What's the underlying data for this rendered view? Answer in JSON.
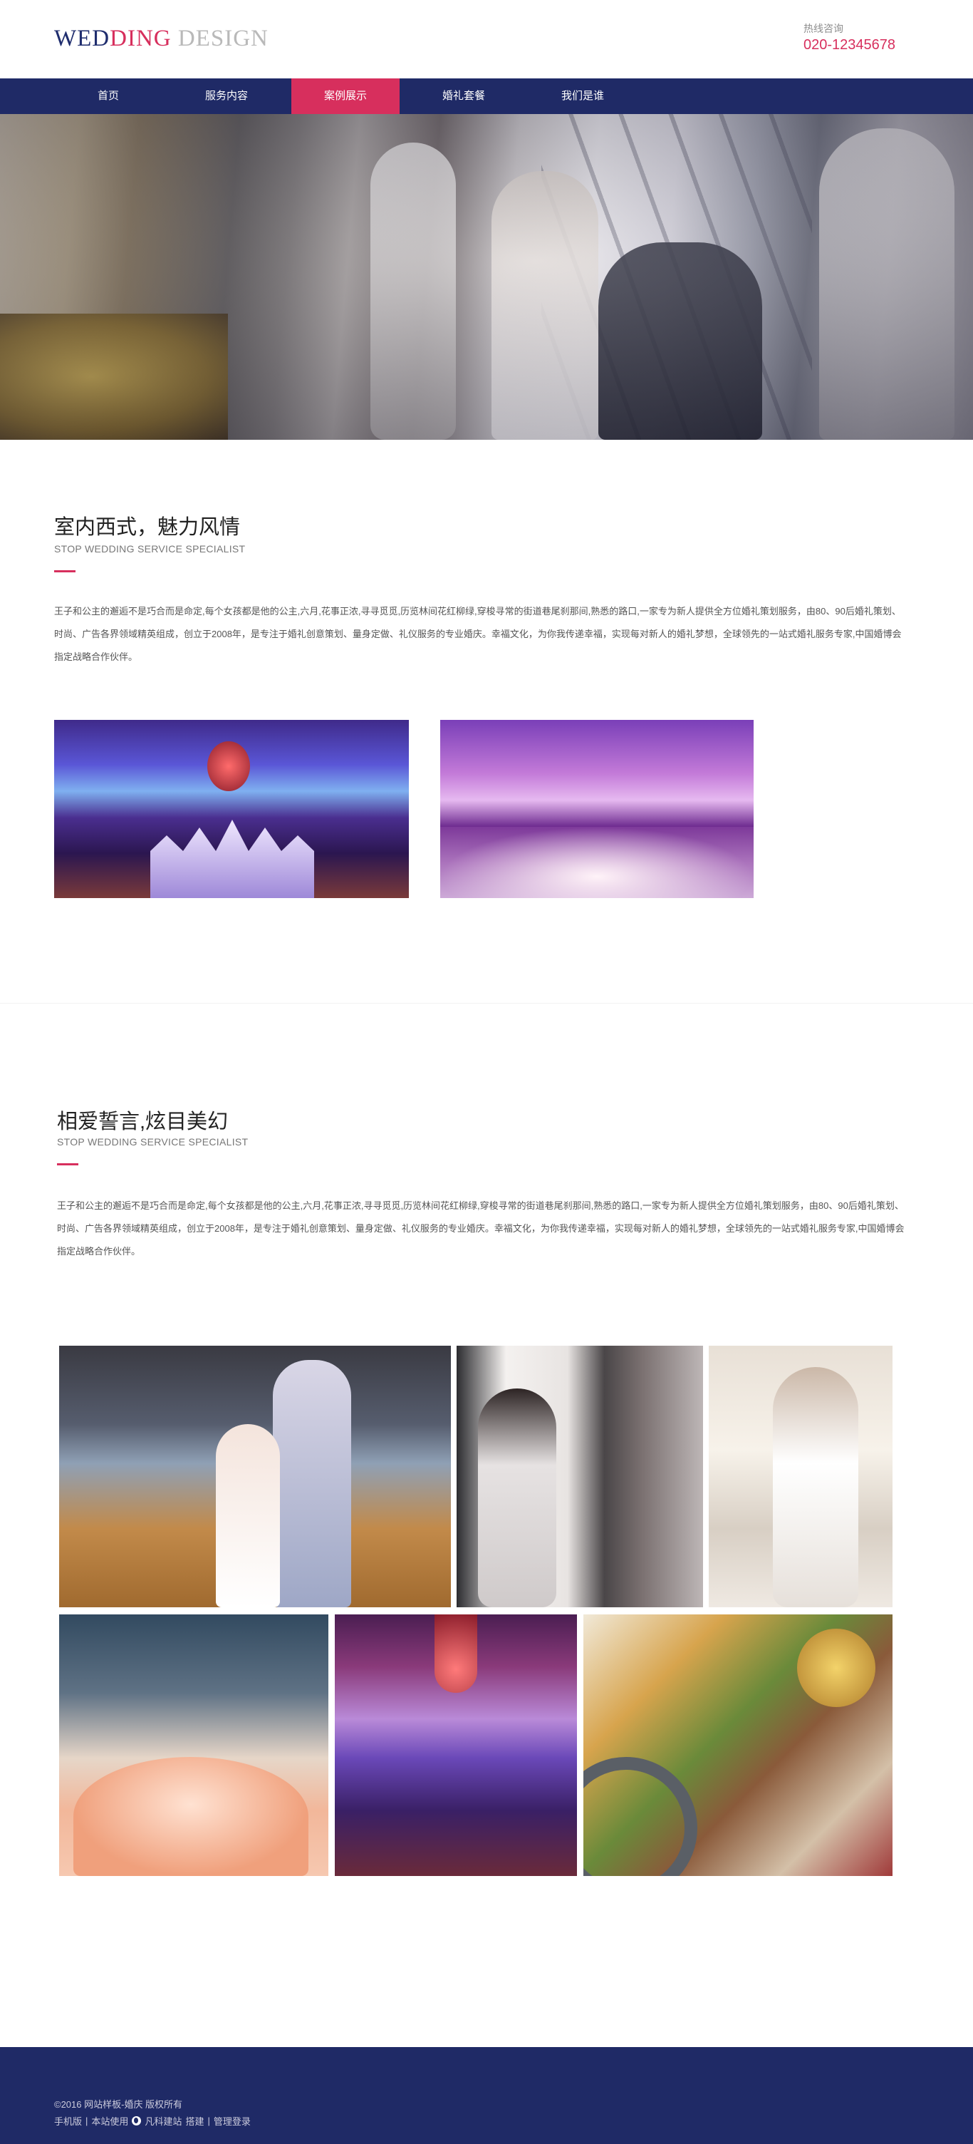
{
  "header": {
    "logo": {
      "part1": "WED",
      "part2": "DING",
      "part3": " DESIGN"
    },
    "hotline_label": "热线咨询",
    "hotline_number": "020-12345678"
  },
  "nav": {
    "items": [
      {
        "label": "首页"
      },
      {
        "label": "服务内容"
      },
      {
        "label": "案例展示"
      },
      {
        "label": "婚礼套餐"
      },
      {
        "label": "我们是谁"
      }
    ],
    "active_index": 2
  },
  "section1": {
    "title": "室内西式，魅力风情",
    "subtitle": "STOP WEDDING SERVICE SPECIALIST",
    "text": "王子和公主的邂逅不是巧合而是命定,每个女孩都是他的公主,六月,花事正浓,寻寻觅觅,历览林间花红柳绿,穿梭寻常的街道巷尾刹那间,熟悉的路口,一家专为新人提供全方位婚礼策划服务，由80、90后婚礼策划、时尚、广告各界领域精英组成，创立于2008年，是专注于婚礼创意策划、量身定做、礼仪服务的专业婚庆。幸福文化，为你我传递幸福，实现每对新人的婚礼梦想，全球领先的一站式婚礼服务专家,中国婚博会指定战略合作伙伴。"
  },
  "section2": {
    "title": "相爱誓言,炫目美幻",
    "subtitle": "STOP WEDDING SERVICE SPECIALIST",
    "text": "王子和公主的邂逅不是巧合而是命定,每个女孩都是他的公主,六月,花事正浓,寻寻觅觅,历览林间花红柳绿,穿梭寻常的街道巷尾刹那间,熟悉的路口,一家专为新人提供全方位婚礼策划服务，由80、90后婚礼策划、时尚、广告各界领域精英组成，创立于2008年，是专注于婚礼创意策划、量身定做、礼仪服务的专业婚庆。幸福文化，为你我传递幸福，实现每对新人的婚礼梦想，全球领先的一站式婚礼服务专家,中国婚博会指定战略合作伙伴。"
  },
  "footer": {
    "copyright": "©2016 网站样板-婚庆 版权所有",
    "mobile_label": "手机版",
    "sep": "|",
    "powered_prefix": "本站使用",
    "powered_brand": "凡科建站",
    "powered_suffix": "搭建",
    "admin_label": "管理登录"
  },
  "colors": {
    "brand_navy": "#1f2a66",
    "accent_pink": "#d72f5d"
  }
}
